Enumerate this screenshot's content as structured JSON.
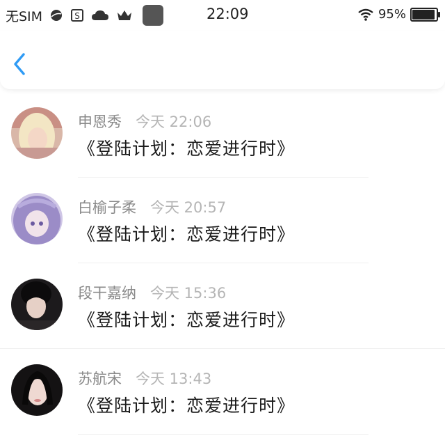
{
  "status_bar": {
    "carrier": "无SIM",
    "time": "22:09",
    "battery_percent": "95%",
    "battery_level": 0.95,
    "icons": [
      "globe-icon",
      "s-badge-icon",
      "cloud-icon",
      "crown-icon",
      "app-square-icon",
      "wifi-icon",
      "battery-icon"
    ]
  },
  "nav": {
    "back_icon": "chevron-left-icon",
    "accent": "#2f9bf5"
  },
  "items": [
    {
      "name": "申恩秀",
      "time": "今天 22:06",
      "content": "《登陆计划：恋爱进行时》",
      "avatar": "avatar-blonde"
    },
    {
      "name": "白榆子柔",
      "time": "今天 20:57",
      "content": "《登陆计划：恋爱进行时》",
      "avatar": "avatar-lavender"
    },
    {
      "name": "段干嘉纳",
      "time": "今天 15:36",
      "content": "《登陆计划：恋爱进行时》",
      "avatar": "avatar-dark"
    },
    {
      "name": "苏航宋",
      "time": "今天 13:43",
      "content": "《登陆计划：恋爱进行时》",
      "avatar": "avatar-black-hair"
    }
  ]
}
